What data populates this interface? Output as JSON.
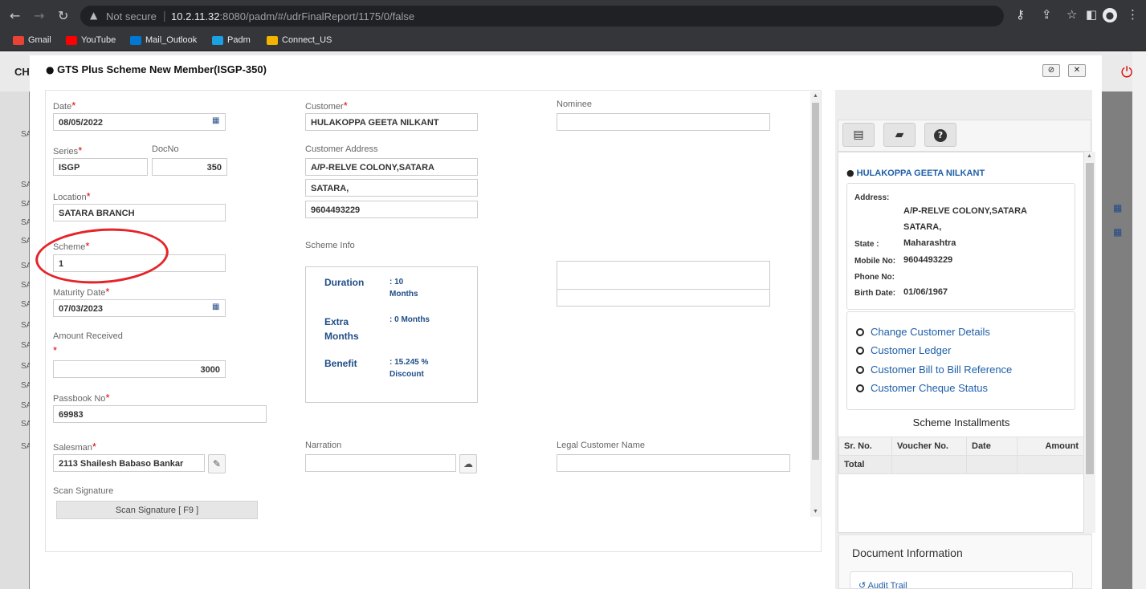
{
  "browser": {
    "not_secure": "Not secure",
    "host": "10.2.11.32",
    "path": ":8080/padm/#/udrFinalReport/1175/0/false",
    "bookmarks": [
      "Gmail",
      "YouTube",
      "Mail_Outlook",
      "Padm",
      "Connect_US"
    ],
    "bookmark_colors": [
      "#ea4335",
      "#ff0000",
      "#0078d4",
      "#1ba1e2",
      "#f2b400"
    ]
  },
  "background_app": {
    "header_text": "CH",
    "side_rows": [
      "SA",
      "SA",
      "SA",
      "SA",
      "SA",
      "SA",
      "SA",
      "SA",
      "SA",
      "SA",
      "SA",
      "SA",
      "SA",
      "SA",
      "SA"
    ]
  },
  "modal": {
    "title": "GTS Plus Scheme New Member(ISGP-350)",
    "form": {
      "date": {
        "label": "Date",
        "value": "08/05/2022"
      },
      "series": {
        "label": "Series",
        "value": "ISGP"
      },
      "docno": {
        "label": "DocNo",
        "value": "350"
      },
      "location": {
        "label": "Location",
        "value": "SATARA BRANCH"
      },
      "scheme": {
        "label": "Scheme",
        "value": "1"
      },
      "maturity_date": {
        "label": "Maturity Date",
        "value": "07/03/2023"
      },
      "amount_received": {
        "label": "Amount Received",
        "value": "3000"
      },
      "passbook_no": {
        "label": "Passbook No",
        "value": "69983"
      },
      "salesman": {
        "label": "Salesman",
        "value": "2113 Shailesh Babaso Bankar"
      },
      "scan_signature": {
        "label": "Scan Signature",
        "button": "Scan Signature [ F9 ]"
      },
      "customer": {
        "label": "Customer",
        "value": "HULAKOPPA GEETA NILKANT"
      },
      "customer_address": {
        "label": "Customer Address",
        "line1": "A/P-RELVE COLONY,SATARA",
        "line2": "SATARA,",
        "line3": "9604493229"
      },
      "scheme_info": {
        "label": "Scheme Info",
        "duration_label": "Duration",
        "duration_value": ": 10 Months",
        "extra_label": "Extra Months",
        "extra_value": ": 0 Months",
        "benefit_label": "Benefit",
        "benefit_value": ": 15.245 % Discount"
      },
      "narration": {
        "label": "Narration",
        "value": ""
      },
      "nominee": {
        "label": "Nominee",
        "value": ""
      },
      "legal_customer_name": {
        "label": "Legal Customer Name",
        "value": ""
      }
    }
  },
  "right_panel": {
    "customer_name": "HULAKOPPA GEETA NILKANT",
    "address_label": "Address:",
    "address_line1": "A/P-RELVE COLONY,SATARA",
    "address_line2": "SATARA,",
    "state_label": "State :",
    "state_value": "Maharashtra",
    "mobile_label": "Mobile No:",
    "mobile_value": "9604493229",
    "phone_label": "Phone No:",
    "phone_value": "",
    "birth_label": "Birth Date:",
    "birth_value": "01/06/1967",
    "links": [
      "Change Customer Details",
      "Customer Ledger",
      "Customer Bill to Bill Reference",
      "Customer Cheque Status"
    ],
    "installments_title": "Scheme Installments",
    "table_headers": [
      "Sr. No.",
      "Voucher No.",
      "Date",
      "Amount"
    ],
    "total_label": "Total",
    "doc_info_title": "Document Information",
    "audit_trail": "Audit Trail"
  }
}
